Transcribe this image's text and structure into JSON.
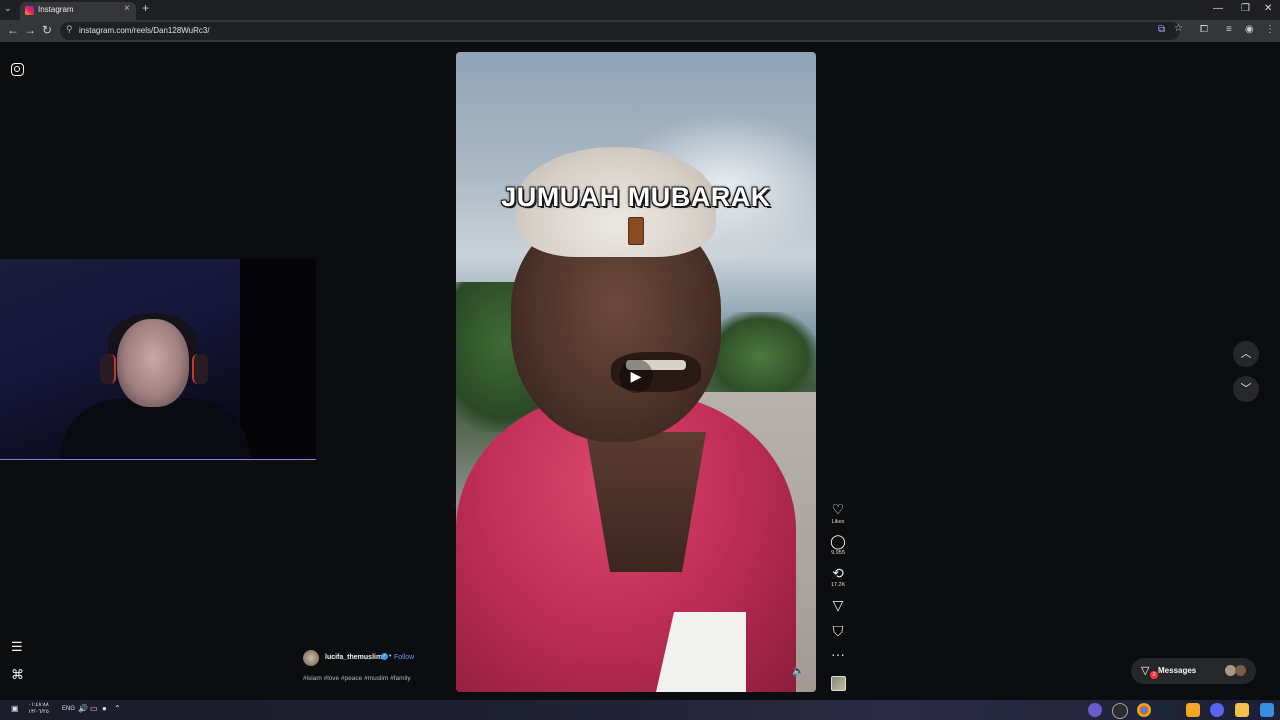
{
  "browser": {
    "tab_title": "Instagram",
    "tab_close": "×",
    "new_tab": "+",
    "url": "instagram.com/reels/Dan128WuRc3/"
  },
  "reel": {
    "overlay_title": "JUMUAH MUBARAK",
    "play_icon": "play-icon",
    "mute_icon": "speaker-icon"
  },
  "actions": {
    "likes_label": "Likes",
    "comments_count": "9,955",
    "reposts_count": "17.2K"
  },
  "author": {
    "username": "lucifa_themuslim",
    "separator": "•",
    "follow_label": "Follow",
    "caption": "#islam #love #peace #muslim #family"
  },
  "messages": {
    "label": "Messages",
    "badge": "2"
  },
  "taskbar": {
    "lang": "ENG",
    "time_line1": "٠١:٤٨:٨٨",
    "time_line2": "١٣/٠٦/٢٥"
  },
  "colors": {
    "follow": "#6b8cff",
    "badge": "#ff3040",
    "verified": "#3897f0",
    "shirt": "#c22f58"
  }
}
